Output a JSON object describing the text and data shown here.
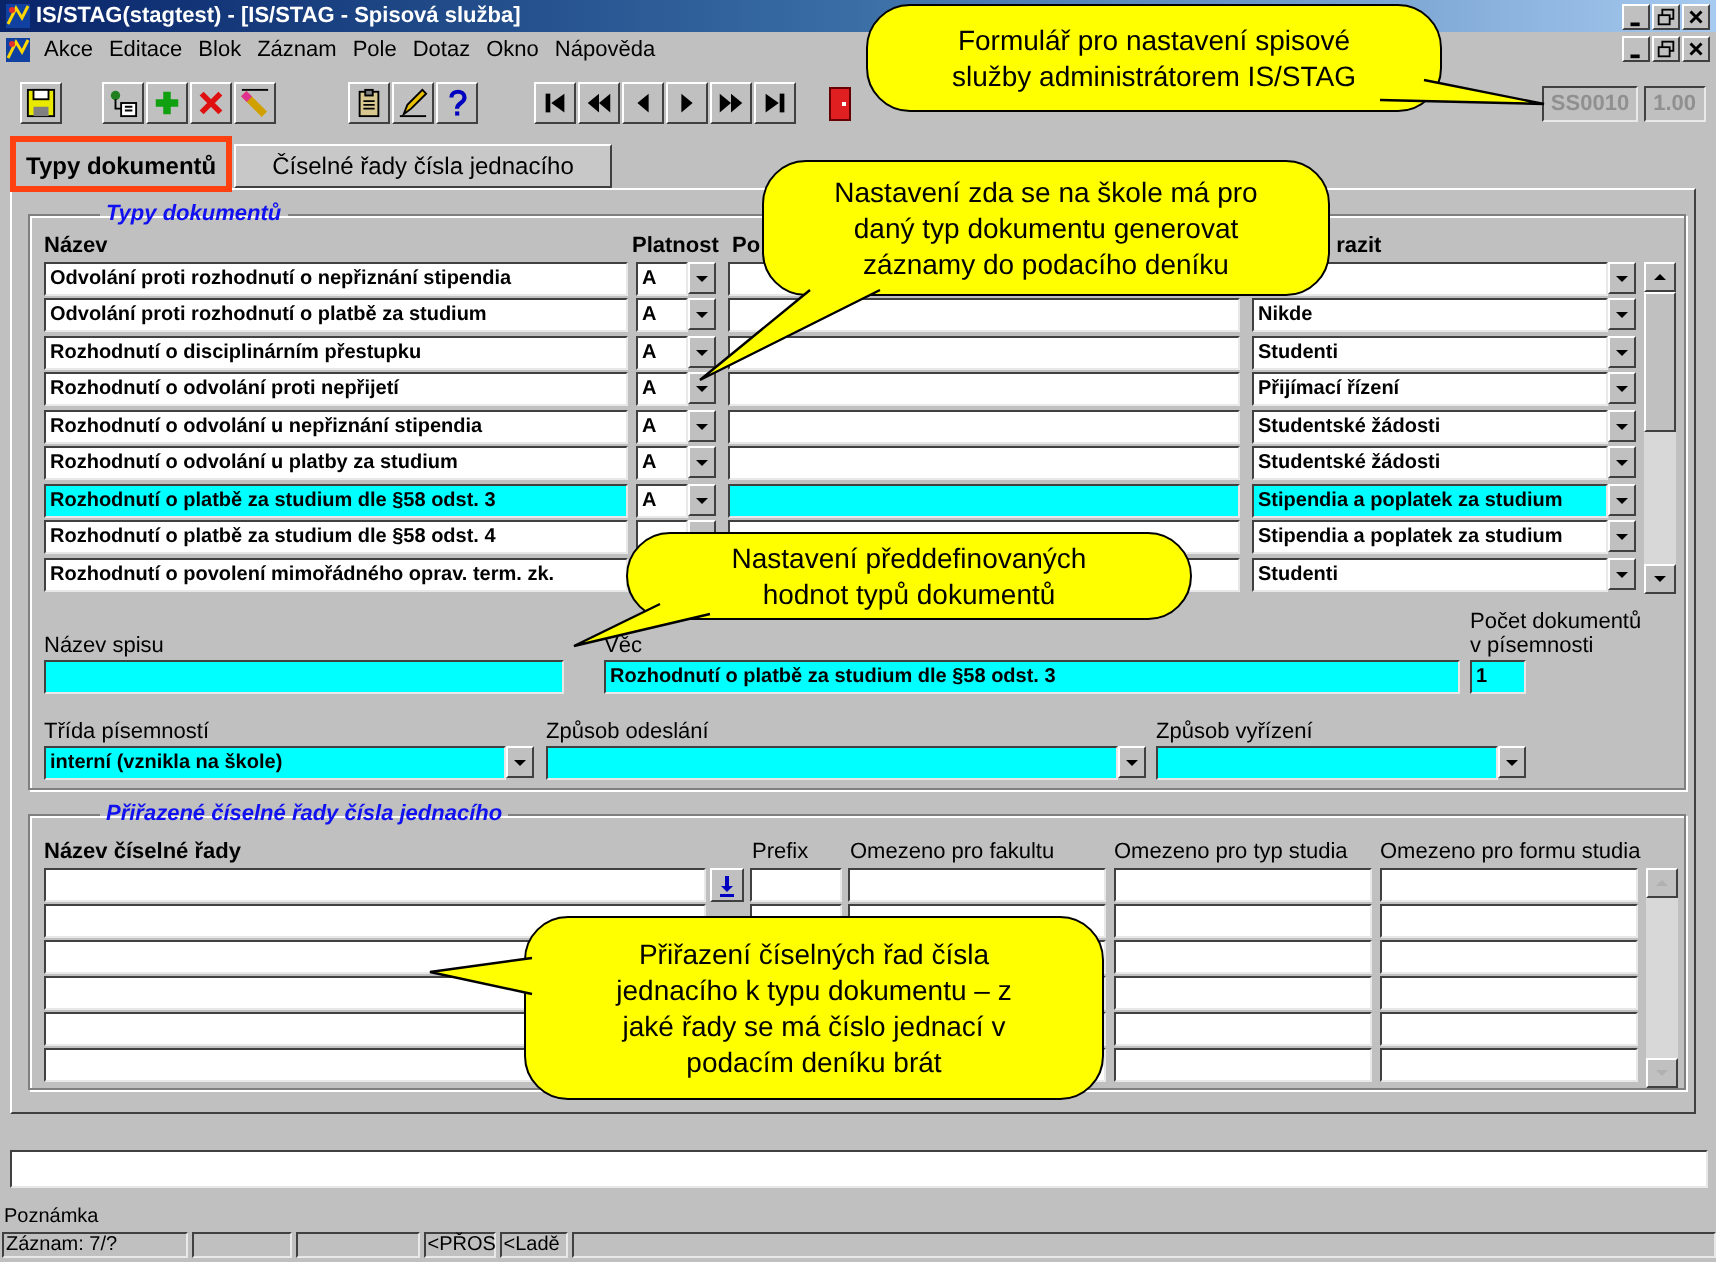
{
  "window": {
    "title": "IS/STAG(stagtest) - [IS/STAG - Spisová služba]"
  },
  "menu": [
    "Akce",
    "Editace",
    "Blok",
    "Záznam",
    "Pole",
    "Dotaz",
    "Okno",
    "Nápověda"
  ],
  "toolbar": {
    "form_code": "SS0010",
    "version": "1.00"
  },
  "tabs": [
    {
      "label": "Typy dokumentů",
      "selected": true,
      "highlighted": true
    },
    {
      "label": "Číselné řady čísla jednacího",
      "selected": false,
      "highlighted": false
    }
  ],
  "document_types": {
    "title": "Typy dokumentů",
    "columns": [
      "Název",
      "Platnost",
      "Po",
      "razit"
    ],
    "rows": [
      {
        "name": "Odvolání proti rozhodnutí o nepřiznání stipendia",
        "validity": "A",
        "selected": false
      },
      {
        "name": "Odvolání proti rozhodnutí o platbě za studium",
        "validity": "A",
        "column_4": "Nikde",
        "selected": false
      },
      {
        "name": "Rozhodnutí o disciplinárním přestupku",
        "validity": "A",
        "column_4": "Studenti",
        "selected": false
      },
      {
        "name": "Rozhodnutí o odvolání proti nepřijetí",
        "validity": "A",
        "column_4": "Přijímací řízení",
        "selected": false
      },
      {
        "name": "Rozhodnutí o odvolání u nepřiznání stipendia",
        "validity": "A",
        "column_4": "Studentské žádosti",
        "selected": false
      },
      {
        "name": "Rozhodnutí o odvolání u platby za studium",
        "validity": "A",
        "column_4": "Studentské žádosti",
        "selected": false
      },
      {
        "name": "Rozhodnutí o platbě za studium dle §58 odst. 3",
        "validity": "A",
        "column_4": "Stipendia a poplatek za studium",
        "selected": true
      },
      {
        "name": "Rozhodnutí o platbě za studium dle §58 odst. 4",
        "column_4": "Stipendia a poplatek za studium",
        "selected": false
      },
      {
        "name": "Rozhodnutí o povolení mimořádného oprav. term. zk.",
        "column_4": "Studenti",
        "selected": false
      }
    ]
  },
  "details": {
    "file_name_label": "Název spisu",
    "subject_label": "Věc",
    "subject": "Rozhodnutí o platbě za studium dle §58 odst. 3",
    "count_label": "Počet dokumentů v písemnosti",
    "count": "1",
    "class_label": "Třída písemností",
    "class": "interní (vznikla na škole)",
    "sending_label": "Způsob odeslání",
    "handling_label": "Způsob vyřízení"
  },
  "number_series": {
    "title": "Přiřazené číselné řady čísla jednacího",
    "columns": [
      "Název číselné řady",
      "Prefix",
      "Omezeno pro fakultu",
      "Omezeno pro typ studia",
      "Omezeno pro formu studia"
    ]
  },
  "status_bar": {
    "note_label": "Poznámka",
    "record": "Záznam: 7/?",
    "mode_1": "<PŘOS",
    "mode_2": "<Ladě"
  },
  "callouts": [
    {
      "text": "Formulář pro nastavení spisové služby administrátorem IS/STAG"
    },
    {
      "text": "Nastavení zda se na škole má pro daný typ dokumentu generovat záznamy do podacího deníku"
    },
    {
      "text": "Nastavení předdefinovaných hodnot typů dokumentů"
    },
    {
      "text": "Přiřazení číselných řad čísla jednacího k typu dokumentu – z jaké řady se má číslo jednací v podacím deníku brát"
    }
  ]
}
